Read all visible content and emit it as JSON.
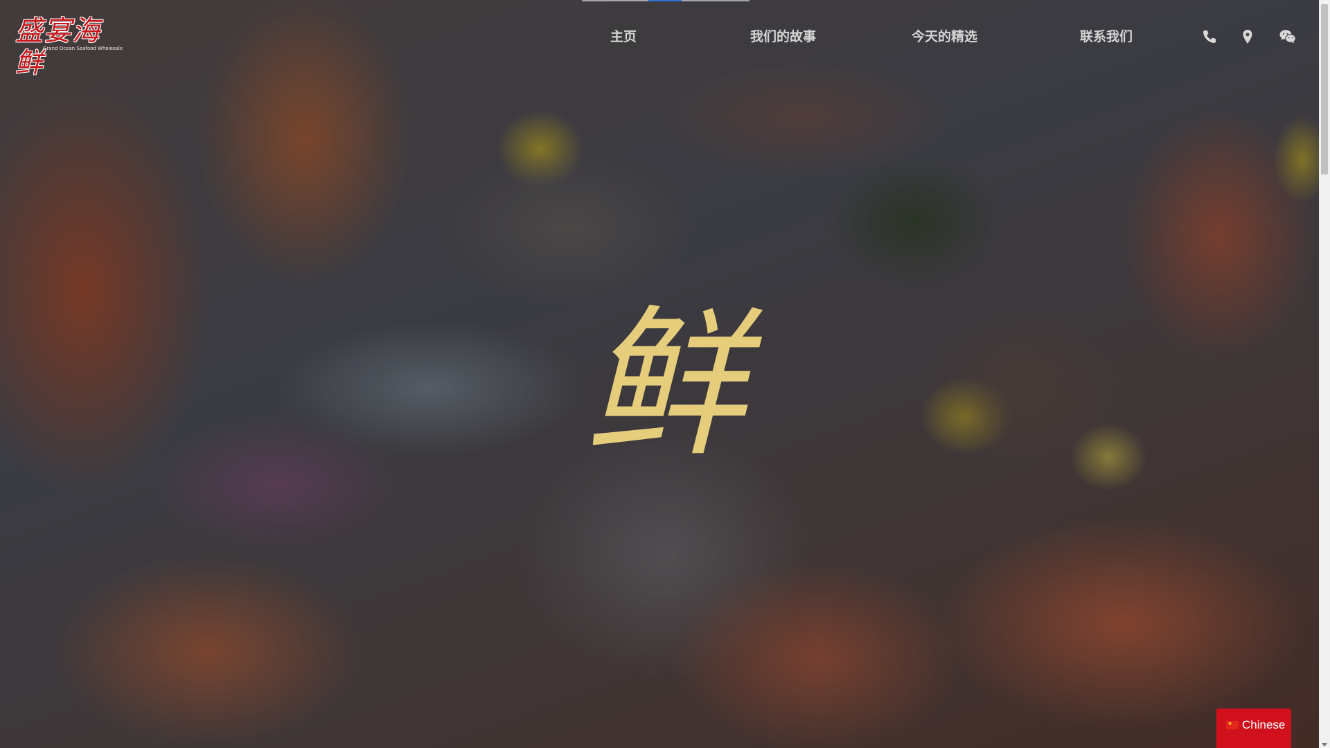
{
  "brand": {
    "logo_text": "盛宴海鲜",
    "logo_subtitle": "Grand Ocean Seafood Wholesale"
  },
  "nav": {
    "items": [
      {
        "label": "主页"
      },
      {
        "label": "我们的故事"
      },
      {
        "label": "今天的精选"
      },
      {
        "label": "联系我们"
      }
    ],
    "icons": [
      "phone-icon",
      "map-marker-icon",
      "wechat-icon"
    ]
  },
  "hero": {
    "glyph": "鲜"
  },
  "language": {
    "label": "Chinese",
    "flag_icon": "china-flag-icon"
  },
  "colors": {
    "brand_red": "#c6161b",
    "glyph_gold": "#e6cd7c",
    "nav_text": "#d5d5d5",
    "lang_button_bg": "#d0111d"
  }
}
